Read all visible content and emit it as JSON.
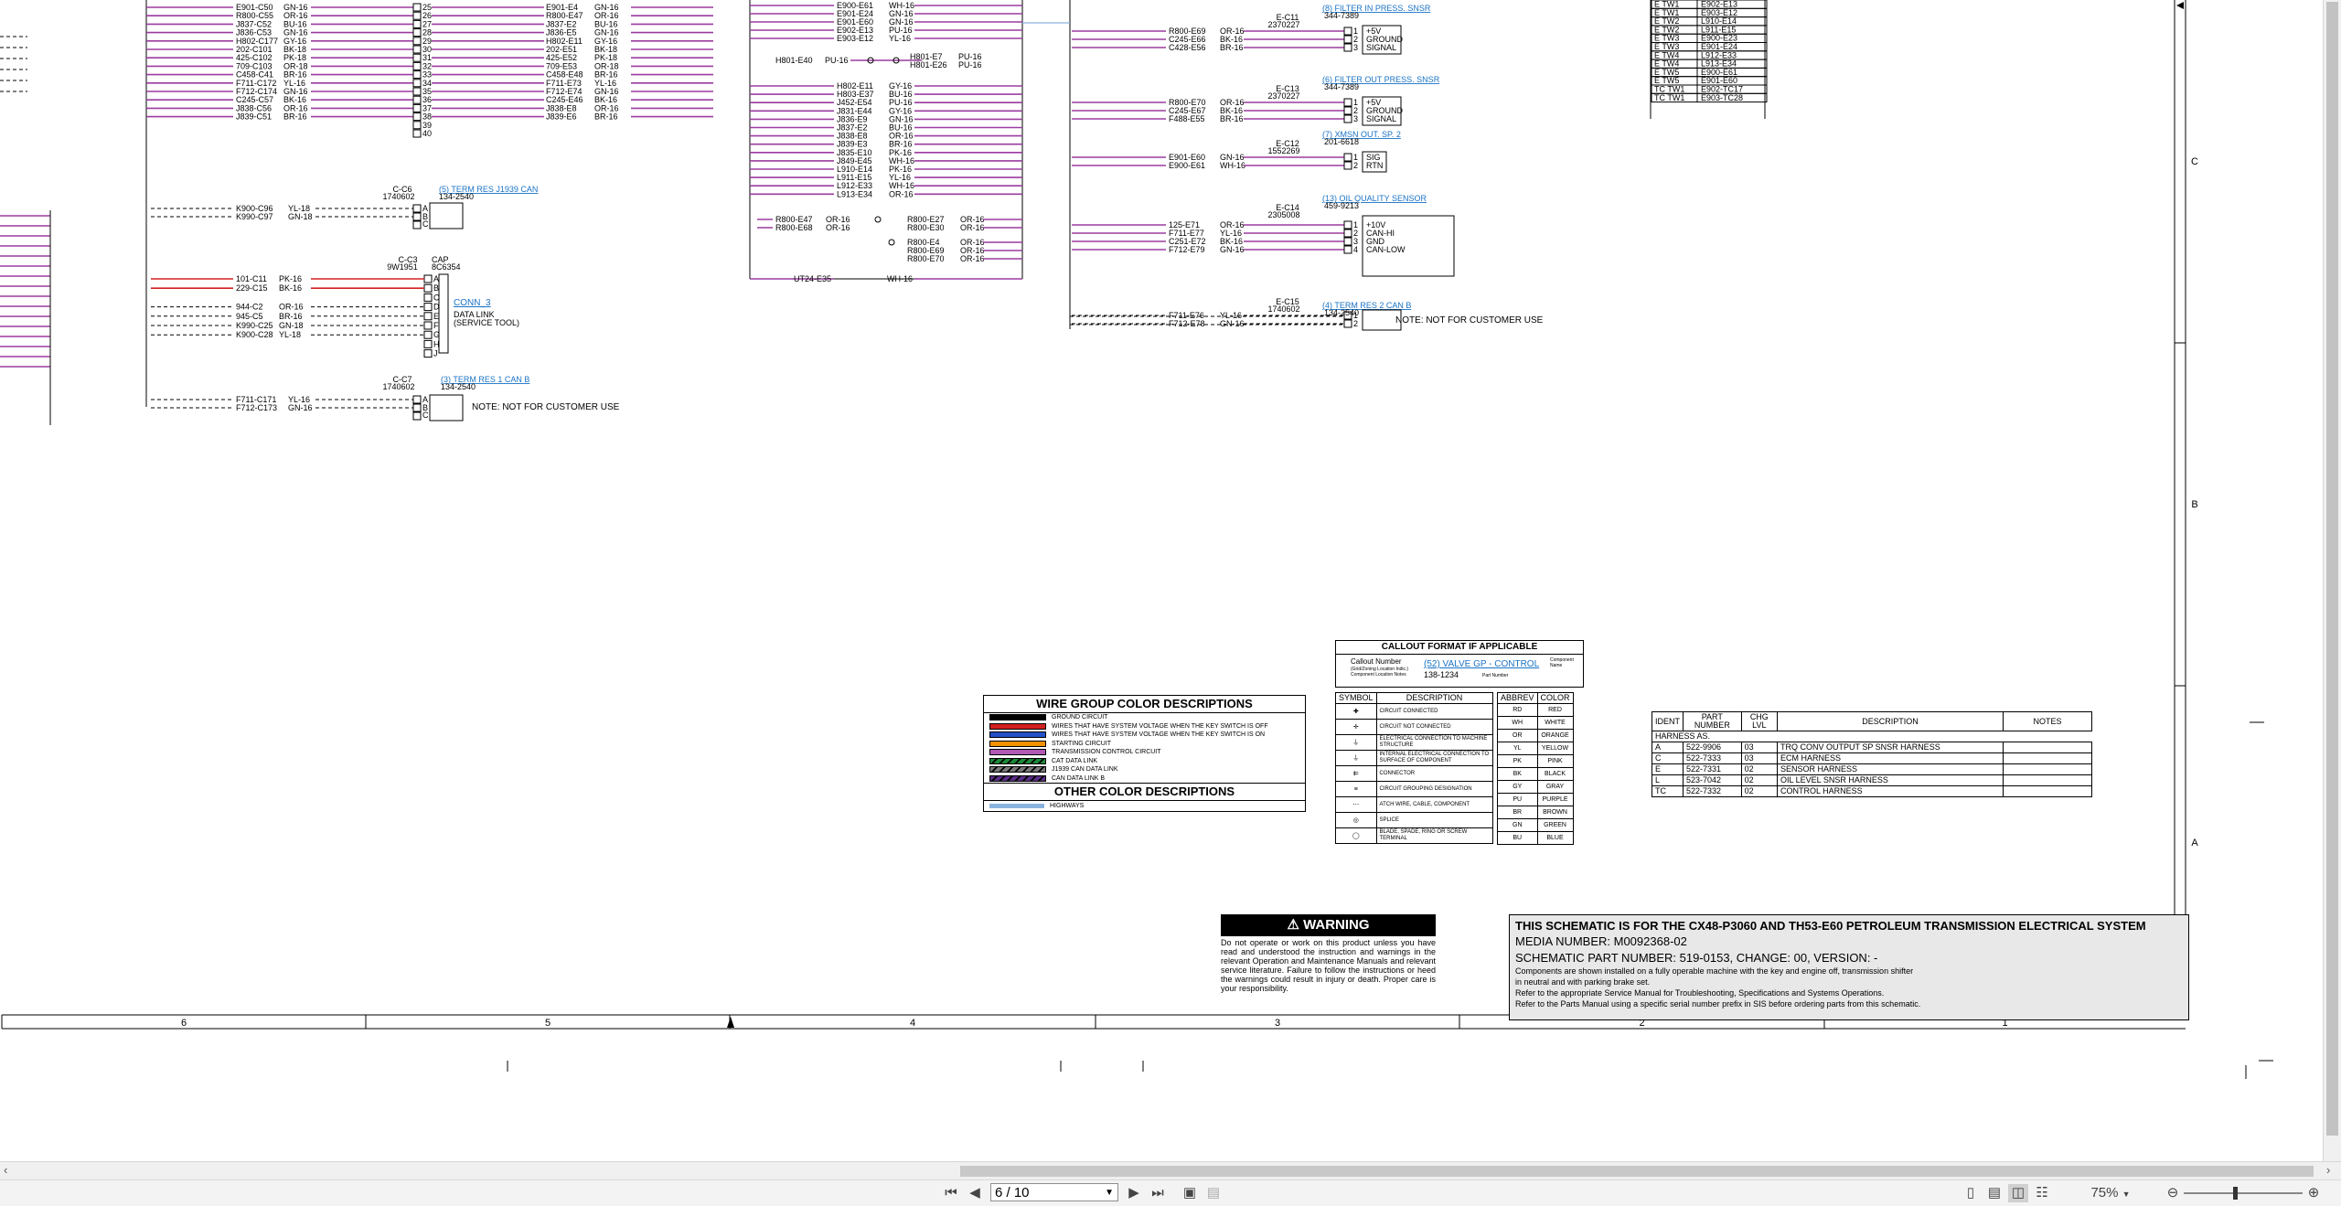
{
  "grid": {
    "cols": [
      "6",
      "5",
      "4",
      "3",
      "2",
      "1"
    ],
    "rows": [
      "C",
      "B",
      "A"
    ]
  },
  "left_block": {
    "rows": [
      {
        "id": "E901-C50",
        "c": "GN-16",
        "pin": "25",
        "r": "E901-E4",
        "rc": "GN-16"
      },
      {
        "id": "R800-C55",
        "c": "OR-16",
        "pin": "26",
        "r": "R800-E47",
        "rc": "OR-16"
      },
      {
        "id": "J837-C52",
        "c": "BU-16",
        "pin": "27",
        "r": "J837-E2",
        "rc": "BU-16"
      },
      {
        "id": "J836-C53",
        "c": "GN-16",
        "pin": "28",
        "r": "J836-E5",
        "rc": "GN-16"
      },
      {
        "id": "H802-C177",
        "c": "GY-16",
        "pin": "29",
        "r": "H802-E11",
        "rc": "GY-16"
      },
      {
        "id": "202-C101",
        "c": "BK-18",
        "pin": "30",
        "r": "202-E51",
        "rc": "BK-18"
      },
      {
        "id": "425-C102",
        "c": "PK-18",
        "pin": "31",
        "r": "425-E52",
        "rc": "PK-18"
      },
      {
        "id": "709-C103",
        "c": "OR-18",
        "pin": "32",
        "r": "709-E53",
        "rc": "OR-18"
      },
      {
        "id": "C458-C41",
        "c": "BR-16",
        "pin": "33",
        "r": "C458-E48",
        "rc": "BR-16"
      },
      {
        "id": "F711-C172",
        "c": "YL-16",
        "pin": "34",
        "r": "F711-E73",
        "rc": "YL-16"
      },
      {
        "id": "F712-C174",
        "c": "GN-16",
        "pin": "35",
        "r": "F712-E74",
        "rc": "GN-16"
      },
      {
        "id": "C245-C57",
        "c": "BK-16",
        "pin": "36",
        "r": "C245-E46",
        "rc": "BK-16"
      },
      {
        "id": "J838-C56",
        "c": "OR-16",
        "pin": "37",
        "r": "J838-E8",
        "rc": "OR-16"
      },
      {
        "id": "J839-C51",
        "c": "BR-16",
        "pin": "38",
        "r": "J839-E6",
        "rc": "BR-16"
      }
    ],
    "extra_pins": [
      "39",
      "40"
    ]
  },
  "c6": {
    "ref": "C-C6",
    "pn": "1740602",
    "title": "(5) TERM RES J1939 CAN",
    "sub": "134-2540",
    "rows": [
      {
        "id": "K900-C96",
        "c": "YL-18",
        "pin": "A"
      },
      {
        "id": "K990-C97",
        "c": "GN-18",
        "pin": "B"
      }
    ],
    "pin_c": "C"
  },
  "c3": {
    "ref": "C-C3",
    "pn": "9W1951",
    "cap": "CAP",
    "cap_pn": "8C6354",
    "title": "CONN_3",
    "desc1": "DATA LINK",
    "desc2": "(SERVICE TOOL)",
    "rows": [
      {
        "id": "101-C11",
        "c": "PK-16",
        "pin": "A"
      },
      {
        "id": "229-C15",
        "c": "BK-16",
        "pin": "B"
      },
      {
        "id": "",
        "c": "",
        "pin": "C"
      },
      {
        "id": "944-C2",
        "c": "OR-16",
        "pin": "D"
      },
      {
        "id": "945-C5",
        "c": "BR-16",
        "pin": "E"
      },
      {
        "id": "K990-C25",
        "c": "GN-18",
        "pin": "F"
      },
      {
        "id": "K900-C28",
        "c": "YL-18",
        "pin": "G"
      }
    ],
    "extra": [
      "H",
      "J"
    ]
  },
  "c7": {
    "ref": "C-C7",
    "pn": "1740602",
    "title": "(3) TERM RES 1 CAN B",
    "sub": "134-2540",
    "note": "NOTE: NOT FOR CUSTOMER USE",
    "rows": [
      {
        "id": "F711-C171",
        "c": "YL-16",
        "pin": "A"
      },
      {
        "id": "F712-C173",
        "c": "GN-16",
        "pin": "B"
      }
    ],
    "pin_c": "C"
  },
  "mid_block": {
    "top": [
      {
        "id": "E900-E61",
        "c": "WH-16"
      },
      {
        "id": "E901-E24",
        "c": "GN-16"
      },
      {
        "id": "E901-E60",
        "c": "GN-16"
      },
      {
        "id": "E902-E13",
        "c": "PU-16"
      },
      {
        "id": "E903-E12",
        "c": "YL-16"
      }
    ],
    "h801": {
      "id": "H801-E40",
      "c": "PU-16",
      "a": "H801-E7",
      "b": "H801-E26",
      "ac": "PU-16",
      "bc": "PU-16"
    },
    "list": [
      {
        "id": "H802-E11",
        "c": "GY-16"
      },
      {
        "id": "H803-E37",
        "c": "BU-16"
      },
      {
        "id": "J452-E54",
        "c": "PU-16"
      },
      {
        "id": "J831-E44",
        "c": "GY-16"
      },
      {
        "id": "J836-E9",
        "c": "GN-16"
      },
      {
        "id": "J837-E2",
        "c": "BU-16"
      },
      {
        "id": "J838-E8",
        "c": "OR-16"
      },
      {
        "id": "J839-E3",
        "c": "BR-16"
      },
      {
        "id": "J835-E10",
        "c": "PK-16"
      },
      {
        "id": "J849-E45",
        "c": "WH-16"
      },
      {
        "id": "L910-E14",
        "c": "PK-16"
      },
      {
        "id": "L911-E15",
        "c": "YL-16"
      },
      {
        "id": "L912-E33",
        "c": "WH-16"
      },
      {
        "id": "L913-E34",
        "c": "OR-16"
      }
    ],
    "splice1": {
      "l1": "R800-E47",
      "l2": "R800-E68",
      "lc": "OR-16",
      "r1": "R800-E27",
      "r2": "R800-E30",
      "rc": "OR-16"
    },
    "splice2": {
      "r1": "R800-E4",
      "r2": "R800-E69",
      "r3": "R800-E70",
      "rc": "OR-16"
    },
    "bottom": {
      "id": "UT24-E35",
      "c": "WH-16"
    }
  },
  "sensors": [
    {
      "ref": "E-C11",
      "pn": "2370227",
      "title": "(8) FILTER IN PRESS. SNSR",
      "sub": "344-7389",
      "rows": [
        {
          "id": "R800-E69",
          "c": "OR-16",
          "p": "+5V"
        },
        {
          "id": "C245-E66",
          "c": "BK-16",
          "p": "GROUND"
        },
        {
          "id": "C428-E56",
          "c": "BR-16",
          "p": "SIGNAL"
        }
      ]
    },
    {
      "ref": "E-C13",
      "pn": "2370227",
      "title": "(6) FILTER OUT PRESS. SNSR",
      "sub": "344-7389",
      "rows": [
        {
          "id": "R800-E70",
          "c": "OR-16",
          "p": "+5V"
        },
        {
          "id": "C245-E67",
          "c": "BK-16",
          "p": "GROUND"
        },
        {
          "id": "F488-E55",
          "c": "BR-16",
          "p": "SIGNAL"
        }
      ]
    },
    {
      "ref": "E-C12",
      "pn": "1552269",
      "title": "(7) XMSN OUT. SP. 2",
      "sub": "201-6618",
      "rows": [
        {
          "id": "E901-E60",
          "c": "GN-16",
          "p": "SIG"
        },
        {
          "id": "E900-E61",
          "c": "WH-16",
          "p": "RTN"
        }
      ]
    },
    {
      "ref": "E-C14",
      "pn": "2305008",
      "title": "(13) OIL QUALITY SENSOR",
      "sub": "459-9213",
      "rows": [
        {
          "id": "125-E71",
          "c": "OR-16",
          "p": "+10V"
        },
        {
          "id": "F711-E77",
          "c": "YL-16",
          "p": "CAN-HI"
        },
        {
          "id": "C251-E72",
          "c": "BK-16",
          "p": "GND"
        },
        {
          "id": "F712-E79",
          "c": "GN-16",
          "p": "CAN-LOW"
        }
      ]
    },
    {
      "ref": "E-C15",
      "pn": "1740602",
      "title": "(4) TERM RES 2 CAN B",
      "sub": "134-2540",
      "note": "NOTE: NOT FOR CUSTOMER USE",
      "rows": [
        {
          "id": "F711-E76",
          "c": "YL-16",
          "p": "A"
        },
        {
          "id": "F712-E78",
          "c": "GN-16",
          "p": "B"
        }
      ]
    }
  ],
  "location_table": {
    "rows": [
      [
        "E TW1",
        "E902-E13"
      ],
      [
        "E TW1",
        "E903-E12"
      ],
      [
        "E TW2",
        "L910-E14"
      ],
      [
        "E TW2",
        "L911-E15"
      ],
      [
        "E TW3",
        "E900-E23"
      ],
      [
        "E TW3",
        "E901-E24"
      ],
      [
        "E TW4",
        "L912-E33"
      ],
      [
        "E TW4",
        "L913-E34"
      ],
      [
        "E TW5",
        "E900-E61"
      ],
      [
        "E TW5",
        "E901-E60"
      ],
      [
        "TC TW1",
        "E902-TC17"
      ],
      [
        "TC TW1",
        "E903-TC28"
      ]
    ]
  },
  "callout": {
    "title": "CALLOUT FORMAT IF APPLICABLE",
    "label1": "Callout Number",
    "label2": "(Grid/Zoning Location Indic.)",
    "label3": "Component Location Notes",
    "example": "(52) VALVE GP - CONTROL",
    "pn": "138-1234",
    "note_r": "Component Name",
    "note_pn": "Part Number"
  },
  "symbols": {
    "h1": "SYMBOL",
    "h2": "DESCRIPTION",
    "h3": "ABBREV",
    "h4": "COLOR",
    "items": [
      "CIRCUIT CONNECTED",
      "CIRCUIT NOT CONNECTED",
      "ELECTRICAL CONNECTION TO MACHINE STRUCTURE",
      "INTERNAL ELECTRICAL CONNECTION TO SURFACE OF COMPONENT",
      "CONNECTOR",
      "CIRCUIT GROUPING DESIGNATION",
      "ATCH WIRE, CABLE, COMPONENT",
      "SPLICE",
      "BLADE, SPADE, RING OR SCREW TERMINAL"
    ],
    "colors": [
      [
        "RD",
        "RED"
      ],
      [
        "WH",
        "WHITE"
      ],
      [
        "OR",
        "ORANGE"
      ],
      [
        "YL",
        "YELLOW"
      ],
      [
        "PK",
        "PINK"
      ],
      [
        "BK",
        "BLACK"
      ],
      [
        "GY",
        "GRAY"
      ],
      [
        "PU",
        "PURPLE"
      ],
      [
        "BR",
        "BROWN"
      ],
      [
        "GN",
        "GREEN"
      ],
      [
        "BU",
        "BLUE"
      ]
    ]
  },
  "wire_groups": {
    "title": "WIRE GROUP COLOR DESCRIPTIONS",
    "items": [
      {
        "label": "GROUND CIRCUIT",
        "color": "#000000"
      },
      {
        "label": "WIRES THAT HAVE SYSTEM VOLTAGE WHEN THE KEY SWITCH IS OFF",
        "color": "#d32020"
      },
      {
        "label": "WIRES THAT HAVE SYSTEM VOLTAGE WHEN THE KEY SWITCH IS ON",
        "color": "#2250c8"
      },
      {
        "label": "STARTING CIRCUIT",
        "color": "#f39200"
      },
      {
        "label": "TRANSMISSION CONTROL CIRCUIT",
        "color": "#b05ab3"
      },
      {
        "label": "CAT DATA LINK",
        "color": "#1c8a3a"
      },
      {
        "label": "J1939 CAN DATA LINK",
        "color": "#7a7a7a"
      },
      {
        "label": "CAN DATA LINK B",
        "color": "#5b2d86"
      }
    ],
    "other_title": "OTHER COLOR DESCRIPTIONS",
    "other": [
      {
        "label": "HIGHWAYS",
        "color": "#8ab4e0"
      }
    ]
  },
  "harness": {
    "headers": [
      "IDENT",
      "PART NUMBER",
      "CHG LVL",
      "DESCRIPTION",
      "NOTES"
    ],
    "group": "HARNESS AS.",
    "rows": [
      [
        "A",
        "522-9906",
        "03",
        "TRQ CONV OUTPUT SP SNSR HARNESS",
        ""
      ],
      [
        "C",
        "522-7333",
        "03",
        "ECM HARNESS",
        ""
      ],
      [
        "E",
        "522-7331",
        "02",
        "SENSOR HARNESS",
        ""
      ],
      [
        "L",
        "523-7042",
        "02",
        "OIL LEVEL SNSR HARNESS",
        ""
      ],
      [
        "TC",
        "522-7332",
        "02",
        "CONTROL HARNESS",
        ""
      ]
    ]
  },
  "warning": {
    "title": "WARNING",
    "text": "Do not operate or work on this product unless you have read and understood the instruction and warnings in the relevant Operation and Maintenance Manuals and relevant service literature. Failure to follow the instructions or heed the warnings could result in injury or death. Proper care is your responsibility."
  },
  "title_block": {
    "line1": "THIS SCHEMATIC IS FOR THE CX48-P3060 AND TH53-E60 PETROLEUM TRANSMISSION ELECTRICAL SYSTEM",
    "line2": "MEDIA NUMBER: M0092368-02",
    "line3": "SCHEMATIC PART NUMBER: 519-0153, CHANGE: 00, VERSION: -",
    "line4": "Components are shown installed on a fully operable machine with the key and engine off, transmission shifter",
    "line5": "in neutral and with parking brake set.",
    "line6": "Refer to the appropriate Service Manual for Troubleshooting, Specifications and Systems Operations.",
    "line7": "Refer to the Parts Manual using a specific serial number prefix in SIS before ordering parts from this schematic."
  },
  "viewer": {
    "page_value": "6 / 10",
    "zoom": "75%",
    "first_icon": "first-page-icon",
    "prev_icon": "prev-page-icon",
    "next_icon": "next-page-icon",
    "last_icon": "last-page-icon"
  }
}
